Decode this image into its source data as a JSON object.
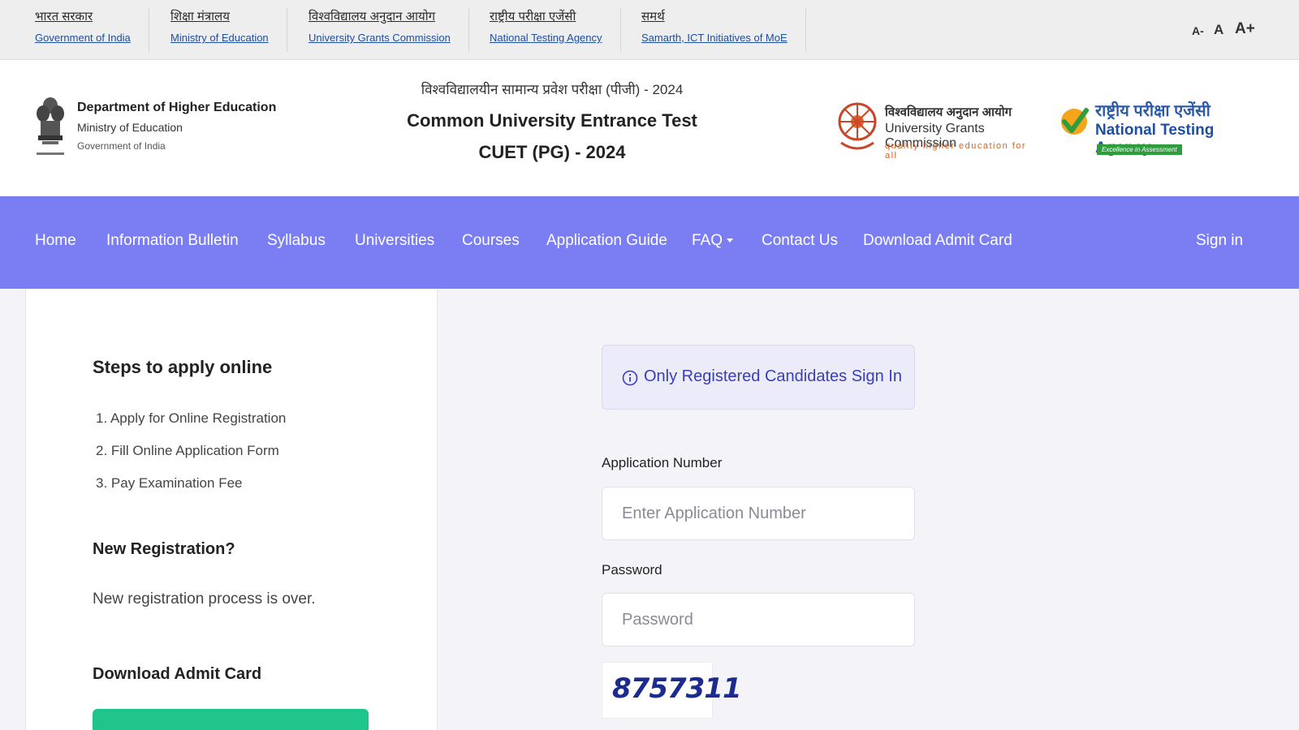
{
  "topbar": {
    "links": [
      {
        "hi": "भारत सरकार",
        "en": "Government of India"
      },
      {
        "hi": "शिक्षा मंत्रालय",
        "en": "Ministry of Education"
      },
      {
        "hi": "विश्वविद्यालय अनुदान आयोग",
        "en": "University Grants Commission"
      },
      {
        "hi": "राष्ट्रीय परीक्षा एजेंसी",
        "en": "National Testing Agency"
      },
      {
        "hi": "समर्थ",
        "en": "Samarth, ICT Initiatives of MoE"
      }
    ],
    "font_controls": {
      "decrease": "A-",
      "normal": "A",
      "increase": "A+"
    }
  },
  "header": {
    "dept_line1": "Department of Higher Education",
    "dept_line2": "Ministry of Education",
    "dept_line3": "Government of India",
    "title_hindi": "विश्वविद्यालयीन सामान्य प्रवेश परीक्षा (पीजी) - 2024",
    "title_en": "Common University Entrance Test",
    "title_exam": "CUET (PG) - 2024",
    "ugc_hi": "विश्वविद्यालय अनुदान आयोग",
    "ugc_en": "University Grants Commission",
    "ugc_tagline": "quality higher education for all",
    "nta_hi": "राष्ट्रीय परीक्षा एजेंसी",
    "nta_en": "National Testing Agency",
    "nta_tagline": "Excellence in Assessment"
  },
  "nav": {
    "items": [
      "Home",
      "Information Bulletin",
      "Syllabus",
      "Universities",
      "Courses",
      "Application Guide",
      "FAQ",
      "Contact Us",
      "Download Admit Card"
    ],
    "signin": "Sign in"
  },
  "left": {
    "steps_title": "Steps to apply online",
    "steps": [
      "1. Apply for Online Registration",
      "2. Fill Online Application Form",
      "3. Pay Examination Fee"
    ],
    "newreg_title": "New Registration?",
    "newreg_text": "New registration process is over.",
    "admit_title": "Download Admit Card"
  },
  "signin": {
    "alert": "Only Registered Candidates Sign In",
    "app_label": "Application Number",
    "app_placeholder": "Enter Application Number",
    "pwd_label": "Password",
    "pwd_placeholder": "Password",
    "captcha": "8757311"
  },
  "colors": {
    "nav": "#7b7ef2",
    "accent": "#3a3fb8",
    "green_button": "#1fc58a"
  }
}
